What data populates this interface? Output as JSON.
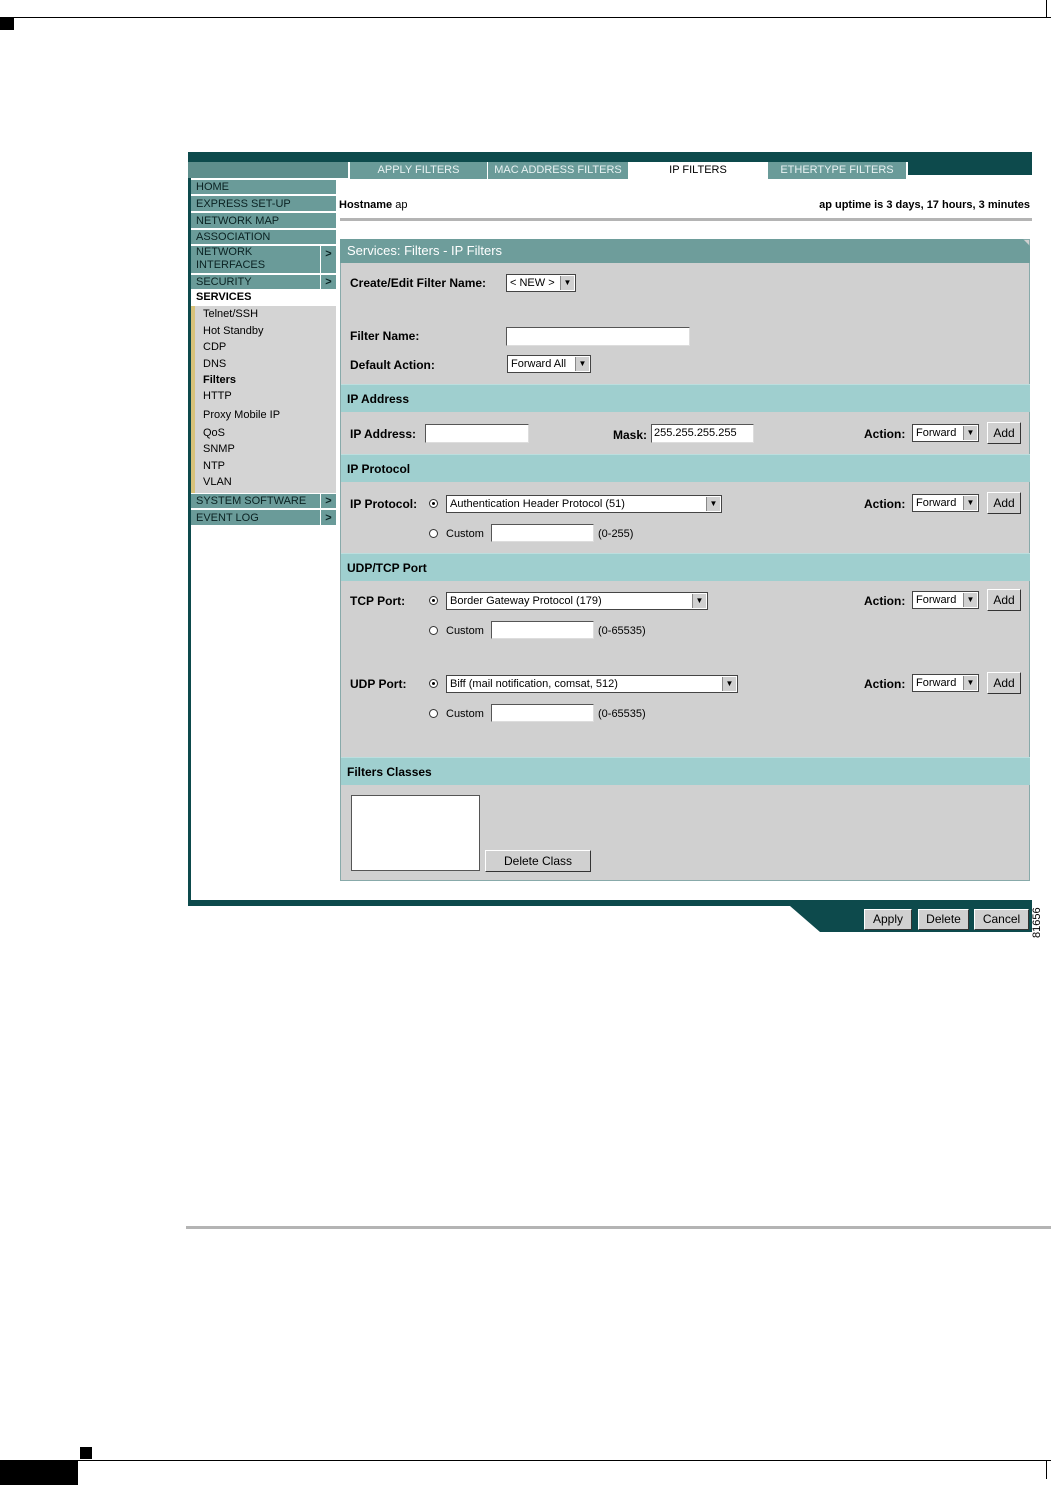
{
  "tabs": [
    "APPLY FILTERS",
    "MAC ADDRESS FILTERS",
    "IP FILTERS",
    "ETHERTYPE FILTERS"
  ],
  "nav": {
    "home": "HOME",
    "express": "EXPRESS SET-UP",
    "network_map": "NETWORK MAP",
    "association": "ASSOCIATION",
    "network_interfaces_1": "NETWORK",
    "network_interfaces_2": "INTERFACES",
    "security": "SECURITY",
    "services": "SERVICES",
    "system_software": "SYSTEM SOFTWARE",
    "event_log": "EVENT LOG",
    "arrow": ">",
    "sub": [
      "Telnet/SSH",
      "Hot Standby",
      "CDP",
      "DNS",
      "Filters",
      "HTTP",
      "Proxy Mobile IP",
      "QoS",
      "SNMP",
      "NTP",
      "VLAN"
    ]
  },
  "host": {
    "label": "Hostname",
    "name": "ap",
    "uptime": "ap uptime is 3 days, 17 hours, 3 minutes"
  },
  "panel": {
    "title": "Services: Filters - IP Filters",
    "create_label": "Create/Edit Filter Name:",
    "create_value": "< NEW >",
    "filter_name_label": "Filter Name:",
    "default_action_label": "Default Action:",
    "default_action_value": "Forward All",
    "ip_address_section": "IP Address",
    "ip_address_label": "IP Address:",
    "mask_label": "Mask:",
    "mask_value": "255.255.255.255",
    "action_label": "Action:",
    "action_value": "Forward",
    "add_label": "Add",
    "ip_protocol_section": "IP Protocol",
    "ip_protocol_label": "IP Protocol:",
    "ip_protocol_value": "Authentication Header Protocol (51)",
    "custom_label": "Custom",
    "protocol_range": "(0-255)",
    "udp_tcp_section": "UDP/TCP Port",
    "tcp_port_label": "TCP Port:",
    "tcp_port_value": "Border Gateway Protocol (179)",
    "port_range": "(0-65535)",
    "udp_port_label": "UDP Port:",
    "udp_port_value": "Biff (mail notification, comsat, 512)",
    "filters_classes_section": "Filters Classes",
    "delete_class_label": "Delete Class"
  },
  "footer": {
    "apply": "Apply",
    "delete": "Delete",
    "cancel": "Cancel"
  },
  "figure_id": "81656"
}
